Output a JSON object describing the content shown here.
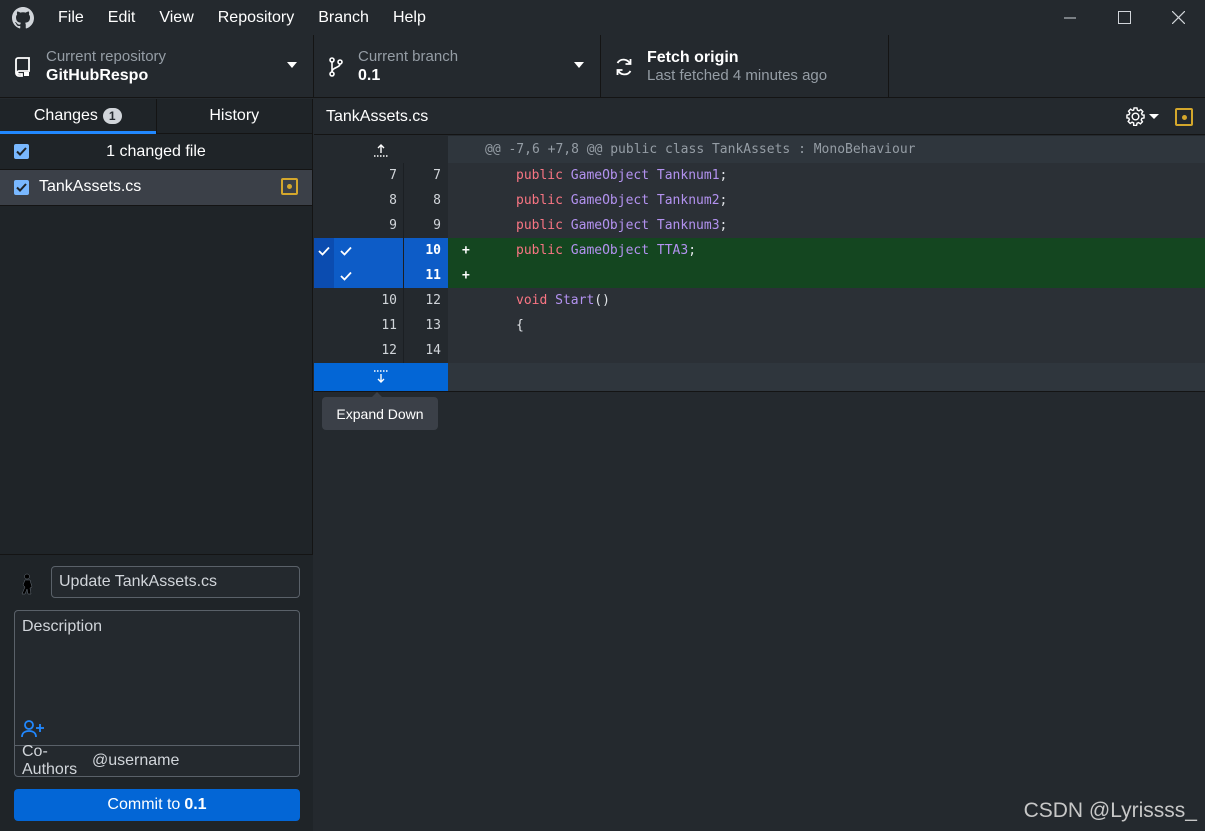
{
  "menu": [
    "File",
    "Edit",
    "View",
    "Repository",
    "Branch",
    "Help"
  ],
  "toolbar": {
    "repo_label": "Current repository",
    "repo_value": "GitHubRespo",
    "branch_label": "Current branch",
    "branch_value": "0.1",
    "fetch_label": "Fetch origin",
    "fetch_sub": "Last fetched 4 minutes ago"
  },
  "sidebar": {
    "tabs": [
      {
        "label": "Changes",
        "count": "1"
      },
      {
        "label": "History"
      }
    ],
    "changed_header": "1 changed file",
    "files": [
      {
        "name": "TankAssets.cs"
      }
    ]
  },
  "commit": {
    "summary_placeholder": "Update TankAssets.cs",
    "description_placeholder": "Description",
    "coauthors_label": "Co-Authors",
    "coauthors_placeholder": "@username",
    "button_prefix": "Commit to",
    "button_branch": "0.1"
  },
  "diff": {
    "file_title": "TankAssets.cs",
    "hunk_header": "@@ -7,6 +7,8 @@ public class TankAssets : MonoBehaviour",
    "lines": [
      {
        "type": "ctx",
        "old": "7",
        "new": "7",
        "kw": "public",
        "ty": "GameObject",
        "id": "Tanknum1",
        "rest": ";"
      },
      {
        "type": "ctx",
        "old": "8",
        "new": "8",
        "kw": "public",
        "ty": "GameObject",
        "id": "Tanknum2",
        "rest": ";"
      },
      {
        "type": "ctx",
        "old": "9",
        "new": "9",
        "kw": "public",
        "ty": "GameObject",
        "id": "Tanknum3",
        "rest": ";"
      },
      {
        "type": "add",
        "old": "",
        "new": "10",
        "marker": "+",
        "kw": "public",
        "ty": "GameObject",
        "id": "TTA3",
        "rest": ";"
      },
      {
        "type": "add",
        "old": "",
        "new": "11",
        "marker": "+",
        "kw": "",
        "ty": "",
        "id": "",
        "rest": ""
      },
      {
        "type": "ctx",
        "old": "10",
        "new": "12",
        "kw": "void",
        "ty": "",
        "id": "Start",
        "rest": "()"
      },
      {
        "type": "ctx",
        "old": "11",
        "new": "13",
        "kw": "",
        "ty": "",
        "id": "",
        "rest": "{"
      },
      {
        "type": "ctx",
        "old": "12",
        "new": "14",
        "kw": "",
        "ty": "",
        "id": "",
        "rest": ""
      }
    ],
    "tooltip": "Expand Down"
  },
  "watermark": "CSDN @Lyrissss_",
  "colors": {
    "accent": "#0366d6",
    "added_bg": "#144620",
    "modified": "#d4a72c",
    "keyword": "#f97583",
    "type": "#b392f0"
  }
}
